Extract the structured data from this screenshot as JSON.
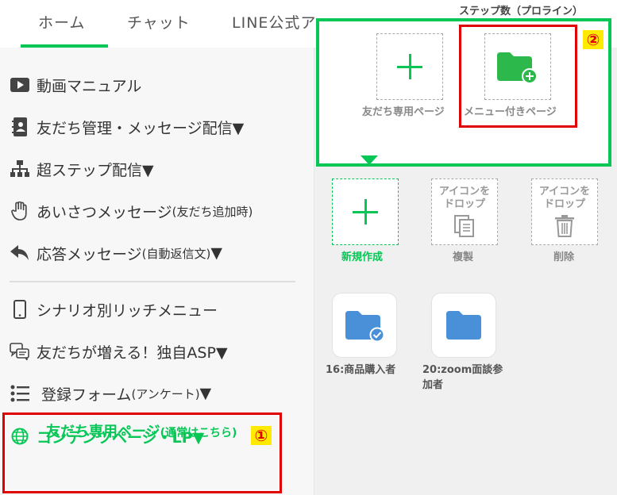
{
  "tabs": {
    "home": "ホーム",
    "chat": "チャット",
    "line_official": "LINE公式ア"
  },
  "sidebar": {
    "items": [
      {
        "icon": "play-video-icon",
        "label": "動画マニュアル"
      },
      {
        "icon": "contact-book-icon",
        "label": "友だち管理・メッセージ配信▼"
      },
      {
        "icon": "sitemap-icon",
        "label": "超ステップ配信▼"
      },
      {
        "icon": "hand-icon",
        "label": "あいさつメッセージ",
        "sub": "(友だち追加時)"
      },
      {
        "icon": "reply-icon",
        "label": "応答メッセージ",
        "sub": "(自動返信文)",
        "suffix": "▼"
      },
      {
        "icon": "smartphone-icon",
        "label": "シナリオ別リッチメニュー"
      },
      {
        "icon": "chat-icon",
        "label": "友だちが増える！独自ASP▼"
      },
      {
        "icon": "list-icon",
        "label": "登録フォーム",
        "sub": "(アンケート)",
        "suffix": "▼"
      },
      {
        "icon": "globe-icon",
        "label": "コンテンツページ・LP▼"
      }
    ],
    "sub_item": {
      "label": "友だち専用ページ",
      "sub": "(通常はこちら)"
    }
  },
  "annotations": {
    "badge1": "①",
    "badge2": "②"
  },
  "panel": {
    "top_caption": "ステップ数（プロライン）",
    "tiles": [
      {
        "label": "友だち専用ページ",
        "icon": "plus-icon"
      },
      {
        "label": "メニュー付きページ",
        "icon": "folder-add-icon"
      }
    ],
    "actions": [
      {
        "label": "新規作成",
        "icon": "plus-icon"
      },
      {
        "label": "複製",
        "drop_text": "アイコンを\nドロップ",
        "icon": "copy-icon"
      },
      {
        "label": "削除",
        "drop_text": "アイコンを\nドロップ",
        "icon": "trash-icon"
      }
    ],
    "folders": [
      {
        "label": "16:商品購入者",
        "icon": "folder-check-icon"
      },
      {
        "label": "20:zoom面談参加者",
        "icon": "folder-icon"
      }
    ]
  },
  "colors": {
    "accent_green": "#06c755",
    "highlight_red": "#e00000",
    "badge_yellow": "#ffea00",
    "folder_green": "#2cb84b",
    "folder_blue": "#4a90d9"
  }
}
